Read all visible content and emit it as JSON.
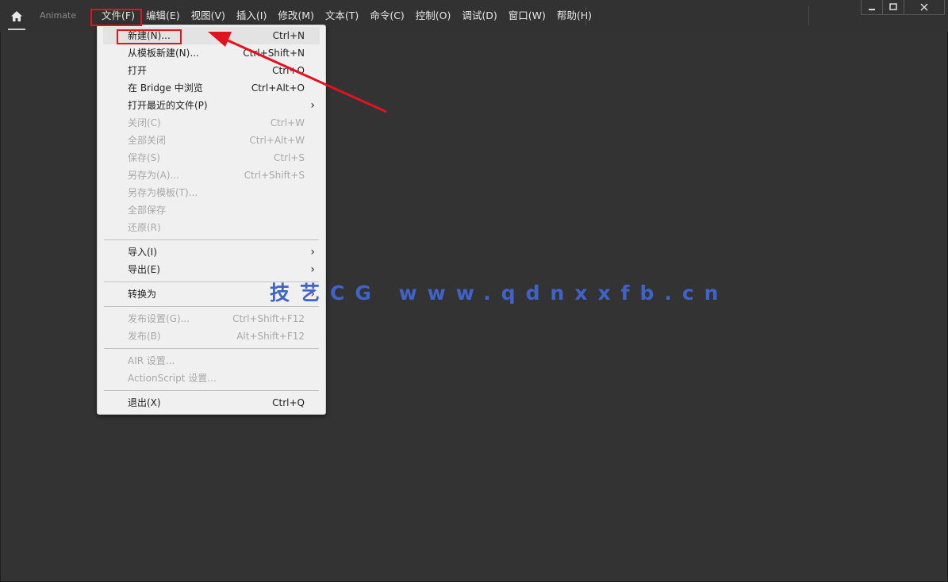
{
  "app": {
    "name": "Animate"
  },
  "menubar": [
    "文件(F)",
    "编辑(E)",
    "视图(V)",
    "插入(I)",
    "修改(M)",
    "文本(T)",
    "命令(C)",
    "控制(O)",
    "调试(D)",
    "窗口(W)",
    "帮助(H)"
  ],
  "file_menu": {
    "new": {
      "label": "新建(N)...",
      "shortcut": "Ctrl+N"
    },
    "from_template": {
      "label": "从模板新建(N)...",
      "shortcut": "Ctrl+Shift+N"
    },
    "open": {
      "label": "打开",
      "shortcut": "Ctrl+O"
    },
    "bridge": {
      "label": "在 Bridge 中浏览",
      "shortcut": "Ctrl+Alt+O"
    },
    "recent": {
      "label": "打开最近的文件(P)"
    },
    "close": {
      "label": "关闭(C)",
      "shortcut": "Ctrl+W"
    },
    "close_all": {
      "label": "全部关闭",
      "shortcut": "Ctrl+Alt+W"
    },
    "save": {
      "label": "保存(S)",
      "shortcut": "Ctrl+S"
    },
    "save_as": {
      "label": "另存为(A)...",
      "shortcut": "Ctrl+Shift+S"
    },
    "save_as_template": {
      "label": "另存为模板(T)..."
    },
    "save_all": {
      "label": "全部保存"
    },
    "revert": {
      "label": "还原(R)"
    },
    "import": {
      "label": "导入(I)"
    },
    "export": {
      "label": "导出(E)"
    },
    "convert": {
      "label": "转换为"
    },
    "publish_settings": {
      "label": "发布设置(G)...",
      "shortcut": "Ctrl+Shift+F12"
    },
    "publish": {
      "label": "发布(B)",
      "shortcut": "Alt+Shift+F12"
    },
    "air_settings": {
      "label": "AIR 设置..."
    },
    "actionscript_settings": {
      "label": "ActionScript 设置..."
    },
    "exit": {
      "label": "退出(X)",
      "shortcut": "Ctrl+Q"
    }
  },
  "watermark": "技艺CG www.qdnxxfb.cn",
  "colors": {
    "annotation_red": "#e0141e",
    "watermark_blue": "#3f63c8",
    "background": "#333333"
  }
}
